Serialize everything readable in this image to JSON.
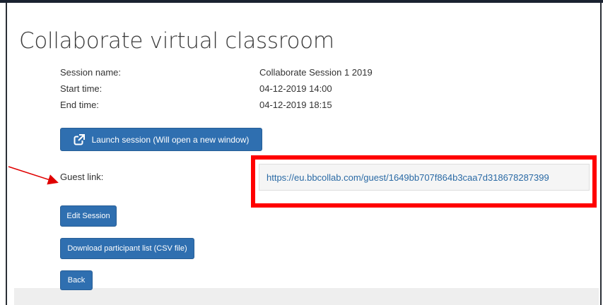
{
  "page": {
    "title": "Collaborate virtual classroom"
  },
  "session": {
    "name_label": "Session name:",
    "name_value": "Collaborate Session 1 2019",
    "start_label": "Start time:",
    "start_value": "04-12-2019 14:00",
    "end_label": "End time:",
    "end_value": "04-12-2019 18:15"
  },
  "buttons": {
    "launch": "Launch session (Will open a new window)",
    "edit": "Edit Session",
    "download": "Download participant list (CSV file)",
    "back": "Back"
  },
  "guest": {
    "label": "Guest link:",
    "url": "https://eu.bbcollab.com/guest/1649bb707f864b3caa7d318678287399"
  },
  "colors": {
    "button": "#2f6fb0",
    "highlight": "#ff0000",
    "link": "#2a6aa5"
  }
}
